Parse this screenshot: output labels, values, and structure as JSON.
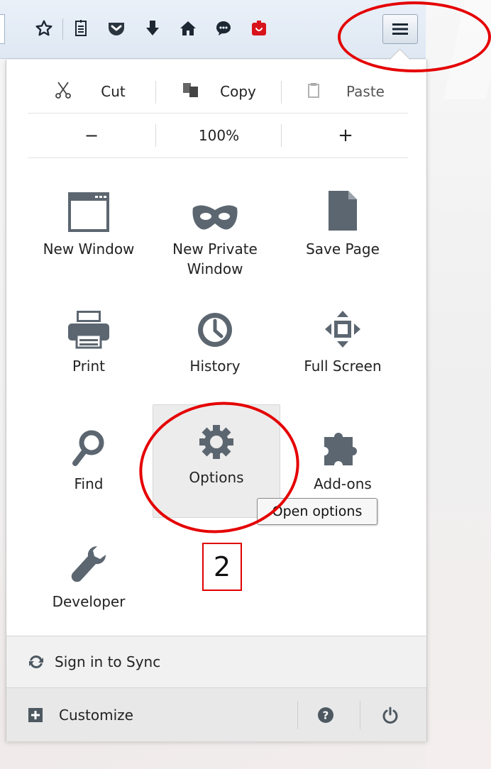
{
  "toolbar": {
    "icons": [
      "bookmark-star-icon",
      "reading-list-icon",
      "pocket-icon",
      "download-icon",
      "home-icon",
      "chat-icon",
      "red-extension-icon"
    ],
    "menu_button": "hamburger-menu-icon"
  },
  "edit": {
    "cut": "Cut",
    "copy": "Copy",
    "paste": "Paste"
  },
  "zoom": {
    "minus": "−",
    "level": "100%",
    "plus": "+"
  },
  "grid": {
    "new_window": "New Window",
    "new_private_window": "New Private Window",
    "save_page": "Save Page",
    "print": "Print",
    "history": "History",
    "full_screen": "Full Screen",
    "find": "Find",
    "options": "Options",
    "addons": "Add-ons",
    "developer": "Developer"
  },
  "tooltip": "Open options",
  "annotation": {
    "step": "2"
  },
  "footer": {
    "sync": "Sign in to Sync",
    "customize": "Customize"
  },
  "colors": {
    "annotation_red": "#e50000",
    "icon_gray": "#5c6670"
  }
}
